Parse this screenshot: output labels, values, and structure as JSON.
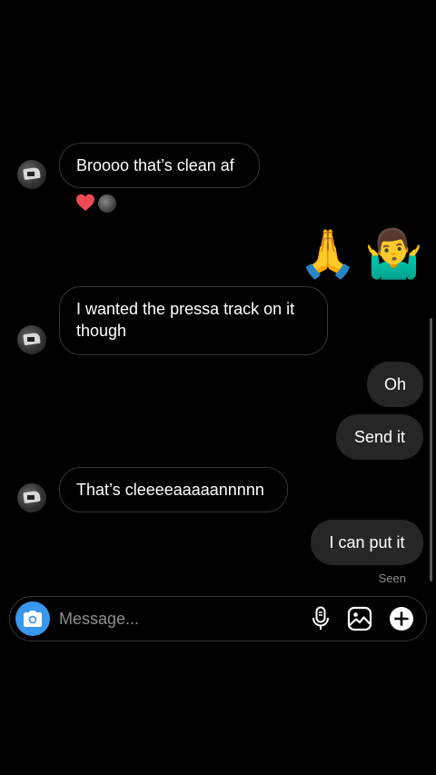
{
  "messages": [
    {
      "direction": "incoming",
      "text": "Broooo that’s clean af"
    },
    {
      "direction": "outgoing",
      "emojis": [
        "🙏",
        "🤷‍♂️"
      ]
    },
    {
      "direction": "incoming",
      "text": "I wanted the pressa track on it though"
    },
    {
      "direction": "outgoing",
      "text": "Oh"
    },
    {
      "direction": "outgoing",
      "text": "Send it"
    },
    {
      "direction": "incoming",
      "text": "That’s cleeeeaaaaannnnn"
    },
    {
      "direction": "outgoing",
      "text": "I can put it"
    }
  ],
  "reactions": {
    "icon": "heart-icon",
    "color": "#ed4956"
  },
  "status": {
    "seen": "Seen"
  },
  "composer": {
    "placeholder": "Message...",
    "camera_icon": "camera-icon",
    "mic_icon": "microphone-icon",
    "gallery_icon": "gallery-icon",
    "add_icon": "plus-icon"
  },
  "colors": {
    "background": "#000000",
    "outgoing_bubble": "#262626",
    "incoming_border": "#363636",
    "accent": "#3897f0",
    "muted_text": "#8e8e8e"
  }
}
